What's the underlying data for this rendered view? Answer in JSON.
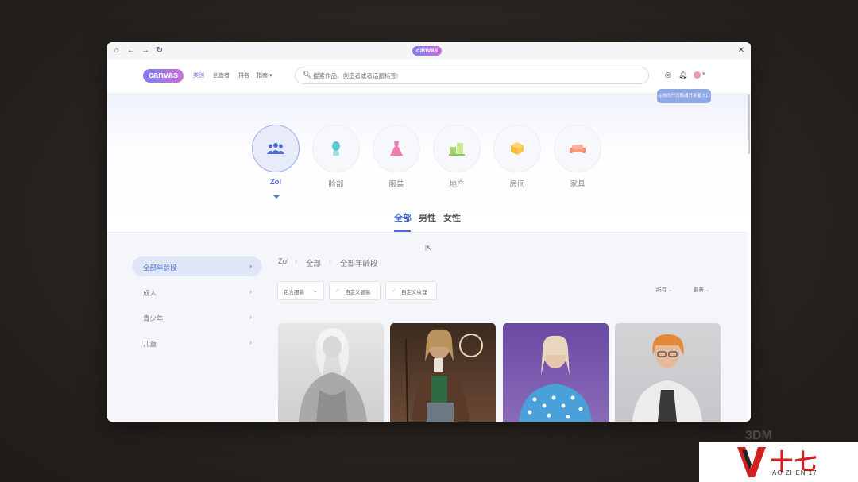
{
  "titlebar": {
    "home_icon": "home-icon",
    "back_icon": "arrow-left-icon",
    "forward_icon": "arrow-right-icon",
    "reload_icon": "reload-icon",
    "logo": "canvas",
    "close_icon": "close-icon"
  },
  "navbar": {
    "logo": "canvas",
    "links": [
      "类别",
      "创造者",
      "排名",
      "指南"
    ],
    "guide_chevron": "▾",
    "search_placeholder": "搜索作品、创造者或者话题标签!",
    "promo_button": "在线的开元商城开发者入口"
  },
  "categories": [
    {
      "label": "Zoi",
      "icon": "people-icon",
      "active": true
    },
    {
      "label": "脸部",
      "icon": "face-icon",
      "active": false
    },
    {
      "label": "服装",
      "icon": "dress-icon",
      "active": false
    },
    {
      "label": "地产",
      "icon": "building-icon",
      "active": false
    },
    {
      "label": "房间",
      "icon": "box-icon",
      "active": false
    },
    {
      "label": "家具",
      "icon": "sofa-icon",
      "active": false
    }
  ],
  "gender_tabs": [
    "全部",
    "男性",
    "女性"
  ],
  "sidebar": [
    {
      "label": "全部年龄段",
      "active": true
    },
    {
      "label": "成人",
      "active": false
    },
    {
      "label": "青少年",
      "active": false
    },
    {
      "label": "儿童",
      "active": false
    }
  ],
  "breadcrumb": [
    "Zoi",
    "全部",
    "全部年龄段"
  ],
  "filters": [
    "包含服装",
    "自定义服装",
    "自定义纹理"
  ],
  "sort": [
    "所有",
    "最新"
  ],
  "cards": [
    {
      "alt": "灰白短发女性角色"
    },
    {
      "alt": "棕色外套女性角色"
    },
    {
      "alt": "紫色背景金发女性角色"
    },
    {
      "alt": "橙发戴眼镜男性角色"
    }
  ],
  "watermark": {
    "ghost": "3DM",
    "chinese": "十七",
    "english": "AO ZHEN 17"
  },
  "colors": {
    "accent": "#4a70d8",
    "brand": "#7d7cf0"
  }
}
